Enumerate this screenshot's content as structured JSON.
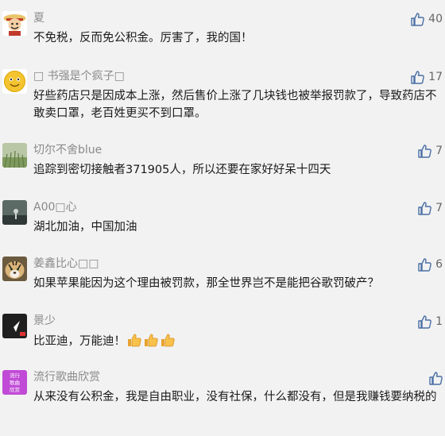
{
  "comments": [
    {
      "username": "夏",
      "likes": "40",
      "text": "不免税，反而免公积金。厉害了，我的国！",
      "avatar": "cartoon-pirate-avatar"
    },
    {
      "username": "□ 书强是个疯子□",
      "likes": "17",
      "text": "好些药店只是因成本上涨，然后售价上涨了几块钱也被举报罚款了，导致药店不敢卖口罩，老百姓更买不到口罩。",
      "avatar": "smiley-face-avatar"
    },
    {
      "username": "切尔不舍blue",
      "likes": "7",
      "text": "追踪到密切接触者371905人，所以还要在家好好呆十四天",
      "avatar": "grass-field-avatar"
    },
    {
      "username": "A00□心",
      "likes": "7",
      "text": "湖北加油，中国加油",
      "avatar": "dark-landscape-avatar"
    },
    {
      "username": "姜鑫比心□□",
      "likes": "6",
      "text": "如果苹果能因为这个理由被罚款，那全世界岂不是能把谷歌罚破产？",
      "avatar": "tiger-avatar"
    },
    {
      "username": "景少",
      "likes": "1",
      "text": "比亚迪，万能迪！",
      "avatar": "app-logo-avatar",
      "emojis": [
        "thumbs-up-emoji",
        "thumbs-up-emoji",
        "thumbs-up-emoji"
      ]
    },
    {
      "username": "流行歌曲欣赏",
      "likes": "",
      "text": "从来没有公积金，我是自由职业，没有社保，什么都没有，但是我赚钱要纳税的",
      "avatar": "purple-text-avatar",
      "avatar_text": "流行\n歌曲\n欣赏"
    }
  ],
  "colors": {
    "background": "#f2f2f2",
    "username": "#8a8a8a",
    "text": "#1a1a1a",
    "like_icon": "#4a6fa5"
  }
}
